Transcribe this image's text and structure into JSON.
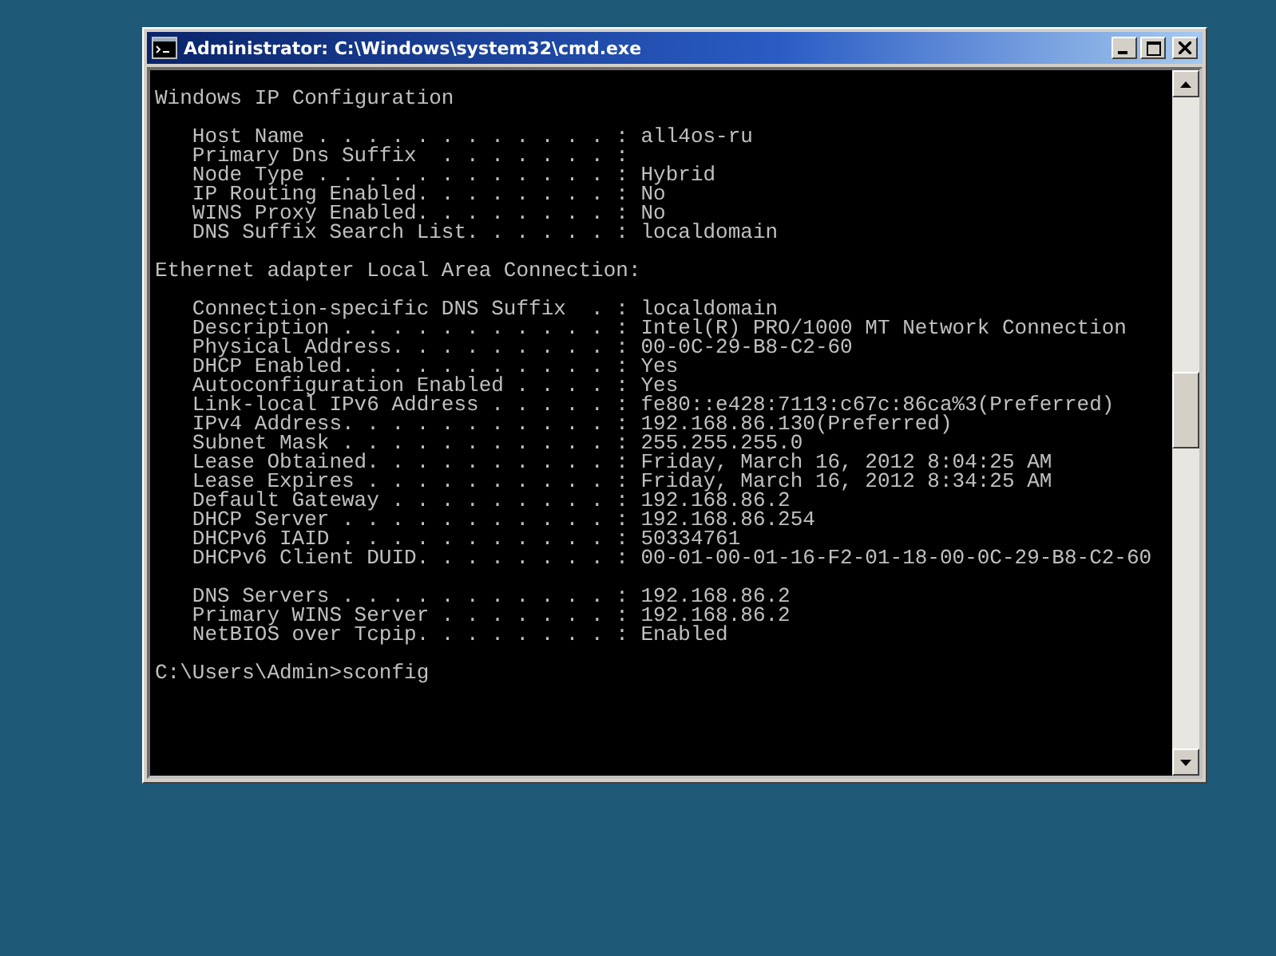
{
  "window": {
    "title": "Administrator: C:\\Windows\\system32\\cmd.exe"
  },
  "console": {
    "lines": [
      {
        "text": "Windows IP Configuration",
        "indented": false,
        "gap_before": true
      },
      {
        "text": "Host Name . . . . . . . . . . . . : all4os-ru",
        "indented": true,
        "gap_before": true
      },
      {
        "text": "Primary Dns Suffix  . . . . . . . :",
        "indented": true,
        "gap_before": false
      },
      {
        "text": "Node Type . . . . . . . . . . . . : Hybrid",
        "indented": true,
        "gap_before": false
      },
      {
        "text": "IP Routing Enabled. . . . . . . . : No",
        "indented": true,
        "gap_before": false
      },
      {
        "text": "WINS Proxy Enabled. . . . . . . . : No",
        "indented": true,
        "gap_before": false
      },
      {
        "text": "DNS Suffix Search List. . . . . . : localdomain",
        "indented": true,
        "gap_before": false
      },
      {
        "text": "Ethernet adapter Local Area Connection:",
        "indented": false,
        "gap_before": true
      },
      {
        "text": "Connection-specific DNS Suffix  . : localdomain",
        "indented": true,
        "gap_before": true
      },
      {
        "text": "Description . . . . . . . . . . . : Intel(R) PRO/1000 MT Network Connection",
        "indented": true,
        "gap_before": false
      },
      {
        "text": "Physical Address. . . . . . . . . : 00-0C-29-B8-C2-60",
        "indented": true,
        "gap_before": false
      },
      {
        "text": "DHCP Enabled. . . . . . . . . . . : Yes",
        "indented": true,
        "gap_before": false
      },
      {
        "text": "Autoconfiguration Enabled . . . . : Yes",
        "indented": true,
        "gap_before": false
      },
      {
        "text": "Link-local IPv6 Address . . . . . : fe80::e428:7113:c67c:86ca%3(Preferred)",
        "indented": true,
        "gap_before": false
      },
      {
        "text": "IPv4 Address. . . . . . . . . . . : 192.168.86.130(Preferred)",
        "indented": true,
        "gap_before": false
      },
      {
        "text": "Subnet Mask . . . . . . . . . . . : 255.255.255.0",
        "indented": true,
        "gap_before": false
      },
      {
        "text": "Lease Obtained. . . . . . . . . . : Friday, March 16, 2012 8:04:25 AM",
        "indented": true,
        "gap_before": false
      },
      {
        "text": "Lease Expires . . . . . . . . . . : Friday, March 16, 2012 8:34:25 AM",
        "indented": true,
        "gap_before": false
      },
      {
        "text": "Default Gateway . . . . . . . . . : 192.168.86.2",
        "indented": true,
        "gap_before": false
      },
      {
        "text": "DHCP Server . . . . . . . . . . . : 192.168.86.254",
        "indented": true,
        "gap_before": false
      },
      {
        "text": "DHCPv6 IAID . . . . . . . . . . . : 50334761",
        "indented": true,
        "gap_before": false
      },
      {
        "text": "DHCPv6 Client DUID. . . . . . . . : 00-01-00-01-16-F2-01-18-00-0C-29-B8-C2-60",
        "indented": true,
        "gap_before": false
      },
      {
        "text": "DNS Servers . . . . . . . . . . . : 192.168.86.2",
        "indented": true,
        "gap_before": true
      },
      {
        "text": "Primary WINS Server . . . . . . . : 192.168.86.2",
        "indented": true,
        "gap_before": false
      },
      {
        "text": "NetBIOS over Tcpip. . . . . . . . : Enabled",
        "indented": true,
        "gap_before": false
      },
      {
        "text": "C:\\Users\\Admin>sconfig",
        "indented": false,
        "gap_before": true
      }
    ]
  }
}
